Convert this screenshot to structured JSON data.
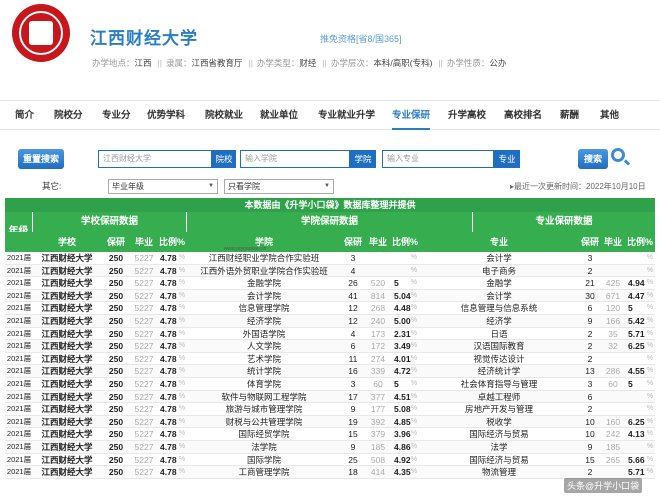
{
  "header": {
    "school_name": "江西财经大学",
    "qualification": "推免资格[省8/国365]",
    "info": [
      {
        "label": "办学地点：",
        "value": "江西"
      },
      {
        "label": "隶属：",
        "value": "江西省教育厅"
      },
      {
        "label": "办学类型：",
        "value": "财经"
      },
      {
        "label": "办学层次：",
        "value": "本科/高职(专科)"
      },
      {
        "label": "办学性质：",
        "value": "公办"
      }
    ]
  },
  "nav": [
    "简介",
    "院校分",
    "专业分",
    "优势学科",
    "院校就业",
    "就业单位",
    "专业就业升学",
    "专业保研",
    "升学高校",
    "高校排名",
    "薪酬",
    "其他"
  ],
  "nav_active": 7,
  "search": {
    "button": "重置搜索",
    "school_value": "江西财经大学",
    "school_btn": "院校",
    "college_placeholder": "输入学院",
    "college_btn": "学院",
    "major_placeholder": "输入专业",
    "major_btn": "专业",
    "search_btn": "搜索"
  },
  "filters": {
    "other_label": "其它:",
    "year_value": "毕业年级",
    "school_only": "只看学院",
    "update_note": "▸最近一次更新时间：2022年10月10日"
  },
  "table": {
    "banner": "本数据由《升学小口袋》数据库整理并提供",
    "year_header": "年级",
    "groups": [
      "学校保研数据",
      "学院保研数据",
      "专业保研数据"
    ],
    "cols_school": [
      "学校",
      "保研",
      "毕业",
      "比例%"
    ],
    "cols_college": [
      "学院",
      "保研",
      "毕业",
      "比例%"
    ],
    "cols_major": [
      "专业",
      "保研",
      "毕业",
      "比例%"
    ],
    "college_watermark": "www.ysygaokao.cn",
    "pct_symbol": "%",
    "rows": [
      [
        "2021届",
        "江西财经大学",
        "250",
        "5227",
        "4.78",
        "江西财经职业学院合作实验班",
        "3",
        "",
        "",
        "会计学",
        "3",
        "",
        ""
      ],
      [
        "2021届",
        "江西财经大学",
        "250",
        "5227",
        "4.78",
        "江西外语外贸职业学院合作实验班",
        "4",
        "",
        "",
        "电子商务",
        "2",
        "",
        ""
      ],
      [
        "2021届",
        "江西财经大学",
        "250",
        "5227",
        "4.78",
        "金融学院",
        "26",
        "520",
        "5",
        "金融学",
        "21",
        "425",
        "4.94"
      ],
      [
        "2021届",
        "江西财经大学",
        "250",
        "5227",
        "4.78",
        "会计学院",
        "41",
        "814",
        "5.04",
        "会计学",
        "30",
        "671",
        "4.47"
      ],
      [
        "2021届",
        "江西财经大学",
        "250",
        "5227",
        "4.78",
        "信息管理学院",
        "12",
        "268",
        "4.48",
        "信息管理与信息系统",
        "6",
        "120",
        "5"
      ],
      [
        "2021届",
        "江西财经大学",
        "250",
        "5227",
        "4.78",
        "经济学院",
        "12",
        "240",
        "5.00",
        "经济学",
        "9",
        "166",
        "5.42"
      ],
      [
        "2021届",
        "江西财经大学",
        "250",
        "5227",
        "4.78",
        "外国语学院",
        "4",
        "173",
        "2.31",
        "日语",
        "2",
        "35",
        "5.71"
      ],
      [
        "2021届",
        "江西财经大学",
        "250",
        "5227",
        "4.78",
        "人文学院",
        "6",
        "172",
        "3.49",
        "汉语国际教育",
        "2",
        "32",
        "6.25"
      ],
      [
        "2021届",
        "江西财经大学",
        "250",
        "5227",
        "4.78",
        "艺术学院",
        "11",
        "274",
        "4.01",
        "视觉传达设计",
        "2",
        "",
        ""
      ],
      [
        "2021届",
        "江西财经大学",
        "250",
        "5227",
        "4.78",
        "统计学院",
        "16",
        "339",
        "4.72",
        "经济统计学",
        "13",
        "286",
        "4.55"
      ],
      [
        "2021届",
        "江西财经大学",
        "250",
        "5227",
        "4.78",
        "体育学院",
        "3",
        "60",
        "5",
        "社会体育指导与管理",
        "3",
        "60",
        "5"
      ],
      [
        "2021届",
        "江西财经大学",
        "250",
        "5227",
        "4.78",
        "软件与物联网工程学院",
        "17",
        "377",
        "4.51",
        "卓越工程师",
        "6",
        "",
        ""
      ],
      [
        "2021届",
        "江西财经大学",
        "250",
        "5227",
        "4.78",
        "旅游与城市管理学院",
        "9",
        "177",
        "5.08",
        "房地产开发与管理",
        "2",
        "",
        ""
      ],
      [
        "2021届",
        "江西财经大学",
        "250",
        "5227",
        "4.78",
        "财税与公共管理学院",
        "19",
        "392",
        "4.85",
        "税收学",
        "10",
        "160",
        "6.25"
      ],
      [
        "2021届",
        "江西财经大学",
        "250",
        "5227",
        "4.78",
        "国际经贸学院",
        "15",
        "379",
        "3.96",
        "国际经济与贸易",
        "10",
        "242",
        "4.13"
      ],
      [
        "2021届",
        "江西财经大学",
        "250",
        "5227",
        "4.78",
        "法学院",
        "9",
        "185",
        "4.86",
        "法学",
        "9",
        "185",
        ""
      ],
      [
        "2021届",
        "江西财经大学",
        "250",
        "5227",
        "4.78",
        "国际学院",
        "25",
        "508",
        "4.92",
        "国际经济与贸易",
        "15",
        "265",
        "5.66"
      ],
      [
        "2021届",
        "江西财经大学",
        "250",
        "5227",
        "4.78",
        "工商管理学院",
        "18",
        "414",
        "4.35",
        "物流管理",
        "2",
        "",
        "5.71"
      ]
    ]
  },
  "watermark": "头条@升学小口袋"
}
